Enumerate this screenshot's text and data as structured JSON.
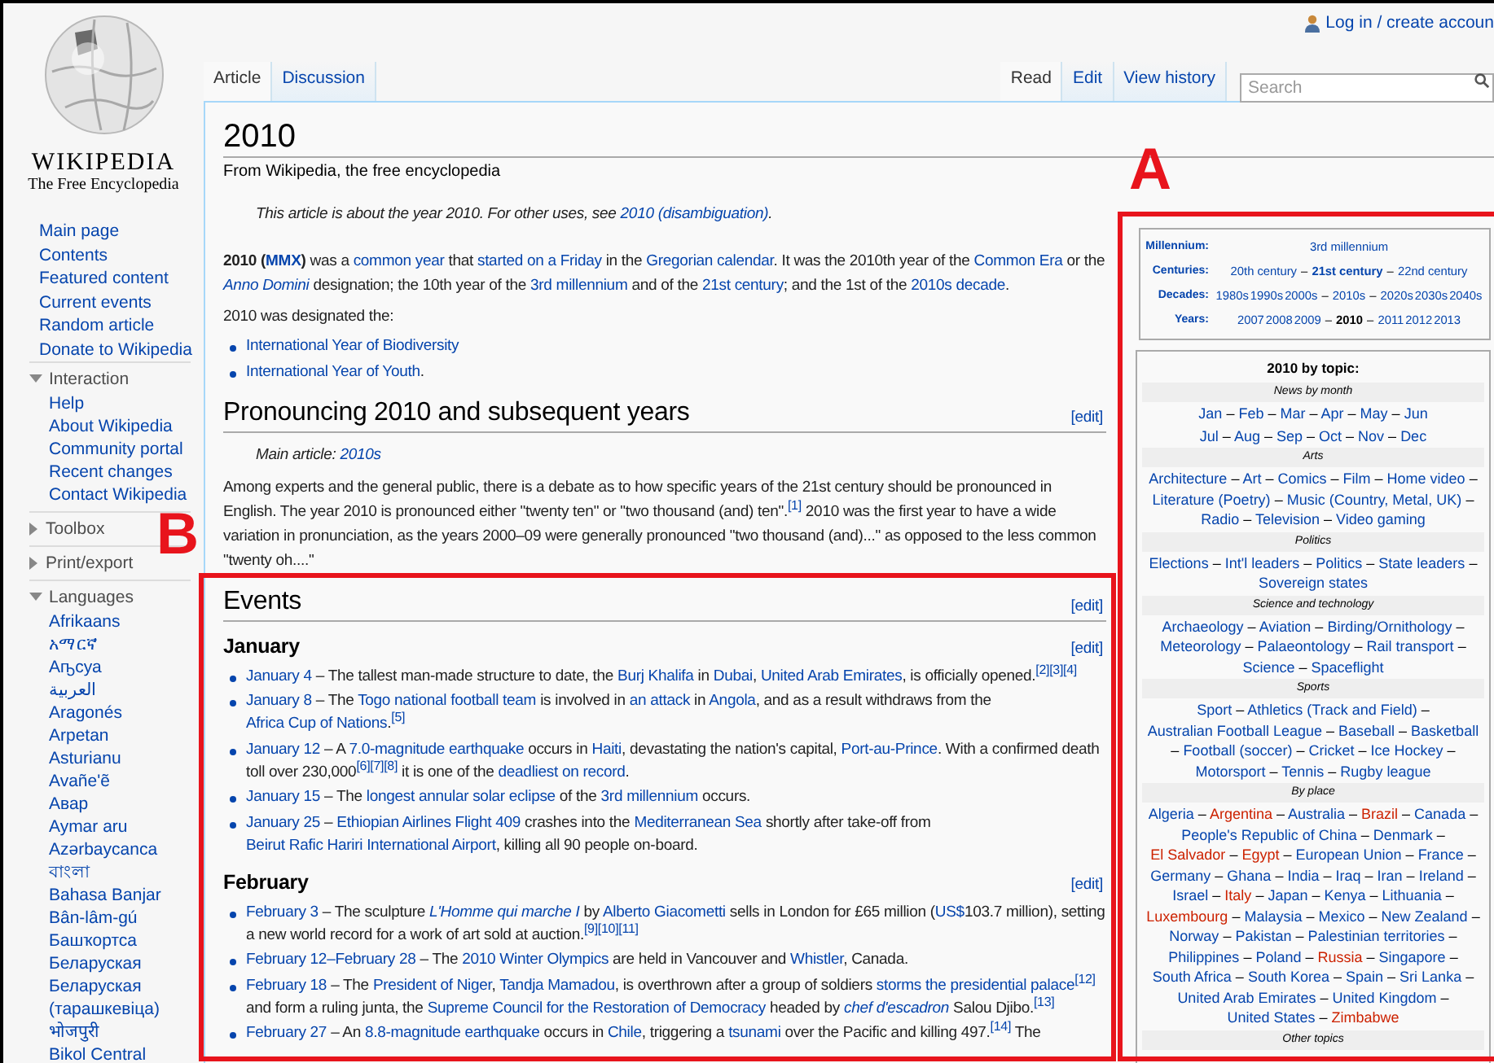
{
  "sidebar": {
    "logo_title": "WIKIPEDIA",
    "logo_tagline": "The Free Encyclopedia",
    "nav": [
      "Main page",
      "Contents",
      "Featured content",
      "Current events",
      "Random article",
      "Donate to Wikipedia"
    ],
    "portals": [
      {
        "title": "Interaction",
        "expanded": true,
        "items": [
          "Help",
          "About Wikipedia",
          "Community portal",
          "Recent changes",
          "Contact Wikipedia"
        ]
      },
      {
        "title": "Toolbox",
        "expanded": false
      },
      {
        "title": "Print/export",
        "expanded": false
      },
      {
        "title": "Languages",
        "expanded": true,
        "items": [
          "Afrikaans",
          "አማርኛ",
          "Аҧсуа",
          "العربية",
          "Aragonés",
          "Arpetan",
          "Asturianu",
          "Avañe'ẽ",
          "Авар",
          "Aymar aru",
          "Azərbaycanca",
          "বাংলা",
          "Bahasa Banjar",
          "Bân-lâm-gú",
          "Башҡортса",
          "Беларуская",
          "Беларуская (тарашкевіца)",
          "भोजपुरी",
          "Bikol Central"
        ]
      }
    ]
  },
  "user_link": "Log in / create accoun",
  "tabs_left": [
    {
      "label": "Article",
      "selected": true
    },
    {
      "label": "Discussion",
      "selected": false
    }
  ],
  "tabs_right": [
    {
      "label": "Read",
      "selected": true
    },
    {
      "label": "Edit",
      "selected": false
    },
    {
      "label": "View history",
      "selected": false
    }
  ],
  "search": {
    "placeholder": "Search"
  },
  "article": {
    "title": "2010",
    "tagline": "From Wikipedia, the free encyclopedia",
    "blocks": [
      {
        "kind": "hatnote",
        "runs": [
          "This article is about the year 2010. For other uses, see ",
          {
            "link": "2010 (disambiguation)"
          },
          "."
        ]
      },
      {
        "kind": "paragraph",
        "runs": [
          {
            "b": "2010 ("
          },
          {
            "link": "MMX",
            "bold": true
          },
          {
            "b": ")"
          },
          " was a ",
          {
            "link": "common year"
          },
          " that ",
          {
            "link": "started on a Friday"
          },
          " in the ",
          {
            "link": "Gregorian calendar"
          },
          ". It was the 2010th year of the ",
          {
            "link": "Common Era"
          },
          " or the ",
          {
            "link": "Anno Domini",
            "italic": true
          },
          " designation; the 10th year of the ",
          {
            "link": "3rd millennium"
          },
          " and of the ",
          {
            "link": "21st century"
          },
          "; and the 1st of the ",
          {
            "link": "2010s decade"
          },
          "."
        ]
      },
      {
        "kind": "paragraph",
        "runs": [
          "2010 was designated the:"
        ]
      },
      {
        "kind": "list",
        "items": [
          [
            {
              "link": "International Year of Biodiversity"
            }
          ],
          [
            {
              "link": "International Year of Youth"
            },
            "."
          ]
        ]
      },
      {
        "kind": "section",
        "text": "Pronouncing 2010 and subsequent years",
        "edit": "[edit]"
      },
      {
        "kind": "hatnote",
        "runs": [
          "Main article: ",
          {
            "link": "2010s"
          }
        ]
      },
      {
        "kind": "paragraph",
        "runs": [
          "Among experts and the general public, there is a debate as to how specific years of the 21st century should be pronounced in English. The year 2010 is pronounced either \"twenty ten\" or \"two thousand (and) ten\".",
          {
            "ref": "[1]"
          },
          " 2010 was the first year to have a wide variation in pronunciation, as the years 2000–09 were generally pronounced \"two thousand (and)...\" as opposed to the less common \"twenty oh....\""
        ]
      },
      {
        "kind": "section",
        "text": "Events",
        "edit": "[edit]"
      },
      {
        "kind": "subsection",
        "text": "January",
        "edit": "[edit]"
      },
      {
        "kind": "list",
        "items": [
          [
            {
              "link": "January 4"
            },
            " – The tallest man-made structure to date, the ",
            {
              "link": "Burj Khalifa"
            },
            " in ",
            {
              "link": "Dubai"
            },
            ", ",
            {
              "link": "United Arab Emirates"
            },
            ", is officially opened.",
            {
              "ref": "[2][3][4]"
            }
          ],
          [
            {
              "link": "January 8"
            },
            " – The ",
            {
              "link": "Togo national football team"
            },
            " is involved in ",
            {
              "link": "an attack"
            },
            " in ",
            {
              "link": "Angola"
            },
            ", and as a result withdraws from the ",
            {
              "link": "Africa Cup of Nations"
            },
            ".",
            {
              "ref": "[5]"
            }
          ],
          [
            {
              "link": "January 12"
            },
            " – A ",
            {
              "link": "7.0-magnitude earthquake"
            },
            " occurs in ",
            {
              "link": "Haiti"
            },
            ", devastating the nation's capital, ",
            {
              "link": "Port-au-Prince"
            },
            ". With a confirmed death toll over 230,000",
            {
              "ref": "[6][7][8]"
            },
            " it is one of the ",
            {
              "link": "deadliest on record"
            },
            "."
          ],
          [
            {
              "link": "January 15"
            },
            " – The ",
            {
              "link": "longest annular solar eclipse"
            },
            " of the ",
            {
              "link": "3rd millennium"
            },
            " occurs."
          ],
          [
            {
              "link": "January 25"
            },
            " – ",
            {
              "link": "Ethiopian Airlines Flight 409"
            },
            " crashes into the ",
            {
              "link": "Mediterranean Sea"
            },
            " shortly after take-off from ",
            {
              "link": "Beirut Rafic Hariri International Airport"
            },
            ", killing all 90 people on-board."
          ]
        ]
      },
      {
        "kind": "subsection",
        "text": "February",
        "edit": "[edit]"
      },
      {
        "kind": "list",
        "items": [
          [
            {
              "link": "February 3"
            },
            " – The sculpture ",
            {
              "link": "L'Homme qui marche I",
              "italic": true
            },
            " by ",
            {
              "link": "Alberto Giacometti"
            },
            " sells in London for £65 million (",
            {
              "link": "US$"
            },
            "103.7 million), setting a new world record for a work of art sold at auction.",
            {
              "ref": "[9][10][11]"
            }
          ],
          [
            {
              "link": "February 12–February 28"
            },
            " – The ",
            {
              "link": "2010 Winter Olympics"
            },
            " are held in Vancouver and ",
            {
              "link": "Whistler"
            },
            ", Canada."
          ],
          [
            {
              "link": "February 18"
            },
            " – The ",
            {
              "link": "President of Niger"
            },
            ", ",
            {
              "link": "Tandja Mamadou"
            },
            ", is overthrown after a group of soldiers ",
            {
              "link": "storms the presidential palace"
            },
            {
              "ref": "[12]"
            },
            " and form a ruling junta, the ",
            {
              "link": "Supreme Council for the Restoration of Democracy"
            },
            " headed by ",
            {
              "link": "chef d'escadron",
              "italic": true
            },
            " Salou Djibo.",
            {
              "ref": "[13]"
            }
          ],
          [
            {
              "link": "February 27"
            },
            " – An ",
            {
              "link": "8.8-magnitude earthquake"
            },
            " occurs in ",
            {
              "link": "Chile"
            },
            ", triggering a ",
            {
              "link": "tsunami"
            },
            " over the Pacific and killing 497.",
            {
              "ref": "[14]"
            },
            " The"
          ]
        ]
      }
    ]
  },
  "infobox": {
    "periods": [
      {
        "label": "Millennium:",
        "runs": [
          {
            "link": "3rd millennium"
          }
        ]
      },
      {
        "label": "Centuries:",
        "runs": [
          {
            "link": "20th century"
          },
          " – ",
          {
            "link": "21st century",
            "bold": true
          },
          " – ",
          {
            "link": "22nd century"
          }
        ]
      },
      {
        "label": "Decades:",
        "runs": [
          {
            "link": "1980s"
          },
          {
            "link": "1990s"
          },
          {
            "link": "2000s"
          },
          " – ",
          {
            "link": "2010s"
          },
          " – ",
          {
            "link": "2020s"
          },
          {
            "link": "2030s"
          },
          {
            "link": "2040s"
          }
        ]
      },
      {
        "label": "Years:",
        "runs": [
          {
            "link": "2007"
          },
          {
            "link": "2008"
          },
          {
            "link": "2009"
          },
          " – ",
          {
            "b": "2010"
          },
          " – ",
          {
            "link": "2011"
          },
          {
            "link": "2012"
          },
          {
            "link": "2013"
          }
        ]
      }
    ],
    "topics_title": "2010 by topic:",
    "separator": " – ",
    "topics": [
      {
        "heading": "News by month",
        "lines": [
          [
            "Jan",
            "Feb",
            "Mar",
            "Apr",
            "May",
            "Jun"
          ],
          [
            "Jul",
            "Aug",
            "Sep",
            "Oct",
            "Nov",
            "Dec"
          ]
        ]
      },
      {
        "heading": "Arts",
        "lines": [
          [
            "Architecture",
            "Art",
            "Comics",
            "Film",
            "Home video",
            "Literature (Poetry)",
            "Music (Country, Metal, UK)",
            "Radio",
            "Television",
            "Video gaming"
          ]
        ]
      },
      {
        "heading": "Politics",
        "lines": [
          [
            "Elections",
            "Int'l leaders",
            "Politics",
            "State leaders",
            "Sovereign states"
          ]
        ]
      },
      {
        "heading": "Science and technology",
        "lines": [
          [
            "Archaeology",
            "Aviation",
            "Birding/Ornithology",
            "Meteorology",
            "Palaeontology",
            "Rail transport",
            "Science",
            "Spaceflight"
          ]
        ]
      },
      {
        "heading": "Sports",
        "lines": [
          [
            "Sport",
            "Athletics (Track and Field)",
            "Australian Football League",
            "Baseball",
            "Basketball",
            "Football (soccer)",
            "Cricket",
            "Ice Hockey",
            "Motorsport",
            "Tennis",
            "Rugby league"
          ]
        ]
      },
      {
        "heading": "By place",
        "lines": [
          [
            {
              "text": "Algeria",
              "red": false
            },
            {
              "text": "Argentina",
              "red": true
            },
            {
              "text": "Australia",
              "red": false
            },
            {
              "text": "Brazil",
              "red": true
            },
            {
              "text": "Canada",
              "red": false
            },
            {
              "text": "People's Republic of China",
              "red": false
            },
            {
              "text": "Denmark",
              "red": false
            },
            {
              "text": "El Salvador",
              "red": true
            },
            {
              "text": "Egypt",
              "red": true
            },
            {
              "text": "European Union",
              "red": false
            },
            {
              "text": "France",
              "red": false
            },
            {
              "text": "Germany",
              "red": false
            },
            {
              "text": "Ghana",
              "red": false
            },
            {
              "text": "India",
              "red": false
            },
            {
              "text": "Iraq",
              "red": false
            },
            {
              "text": "Iran",
              "red": false
            },
            {
              "text": "Ireland",
              "red": false
            },
            {
              "text": "Israel",
              "red": false
            },
            {
              "text": "Italy",
              "red": true
            },
            {
              "text": "Japan",
              "red": false
            },
            {
              "text": "Kenya",
              "red": false
            },
            {
              "text": "Lithuania",
              "red": false
            },
            {
              "text": "Luxembourg",
              "red": true
            },
            {
              "text": "Malaysia",
              "red": false
            },
            {
              "text": "Mexico",
              "red": false
            },
            {
              "text": "New Zealand",
              "red": false
            },
            {
              "text": "Norway",
              "red": false
            },
            {
              "text": "Pakistan",
              "red": false
            },
            {
              "text": "Palestinian territories",
              "red": false
            },
            {
              "text": "Philippines",
              "red": false
            },
            {
              "text": "Poland",
              "red": false
            },
            {
              "text": "Russia",
              "red": true
            },
            {
              "text": "Singapore",
              "red": false
            },
            {
              "text": "South Africa",
              "red": false
            },
            {
              "text": "South Korea",
              "red": false
            },
            {
              "text": "Spain",
              "red": false
            },
            {
              "text": "Sri Lanka",
              "red": false
            },
            {
              "text": "United Arab Emirates",
              "red": false
            },
            {
              "text": "United Kingdom",
              "red": false
            },
            {
              "text": "United States",
              "red": false
            },
            {
              "text": "Zimbabwe",
              "red": true
            }
          ]
        ]
      },
      {
        "heading": "Other topics"
      }
    ]
  },
  "annotations": [
    {
      "letter": "A"
    },
    {
      "letter": "B"
    }
  ]
}
